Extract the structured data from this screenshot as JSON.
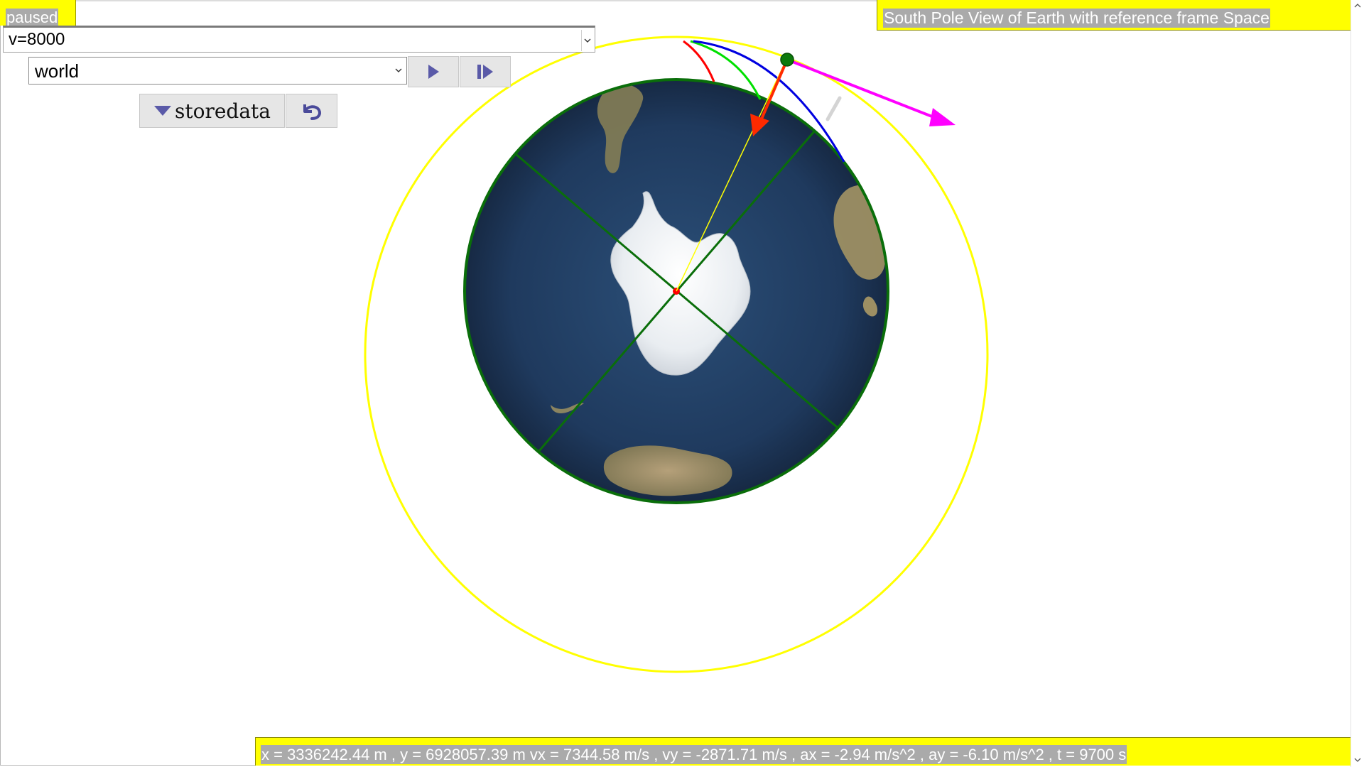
{
  "status": {
    "label": "paused"
  },
  "controls": {
    "velocity_value": "v=8000",
    "frame_value": "world",
    "play_icon": "play-icon",
    "step_icon": "step-forward-icon",
    "store_label": "storedata",
    "store_icon": "triangle-down-icon",
    "undo_icon": "undo-icon"
  },
  "view": {
    "title": "South Pole View of Earth with reference frame Space"
  },
  "readout": {
    "text": "x = 3336242.44 m , y = 6928057.39 m vx = 7344.58 m/s , vy = -2871.71 m/s , ax = -2.94 m/s^2 , ay = -6.10 m/s^2 , t = 9700 s"
  },
  "colors": {
    "panel_yellow": "#ffff00",
    "orbit": "#ffff00",
    "earth_outline": "#0a6e0a",
    "velocity_vector": "#ff00ff",
    "acceleration_vector": "#ff2a00",
    "satellite": "#0c7a0c",
    "ocean": "#1f3a5e"
  }
}
